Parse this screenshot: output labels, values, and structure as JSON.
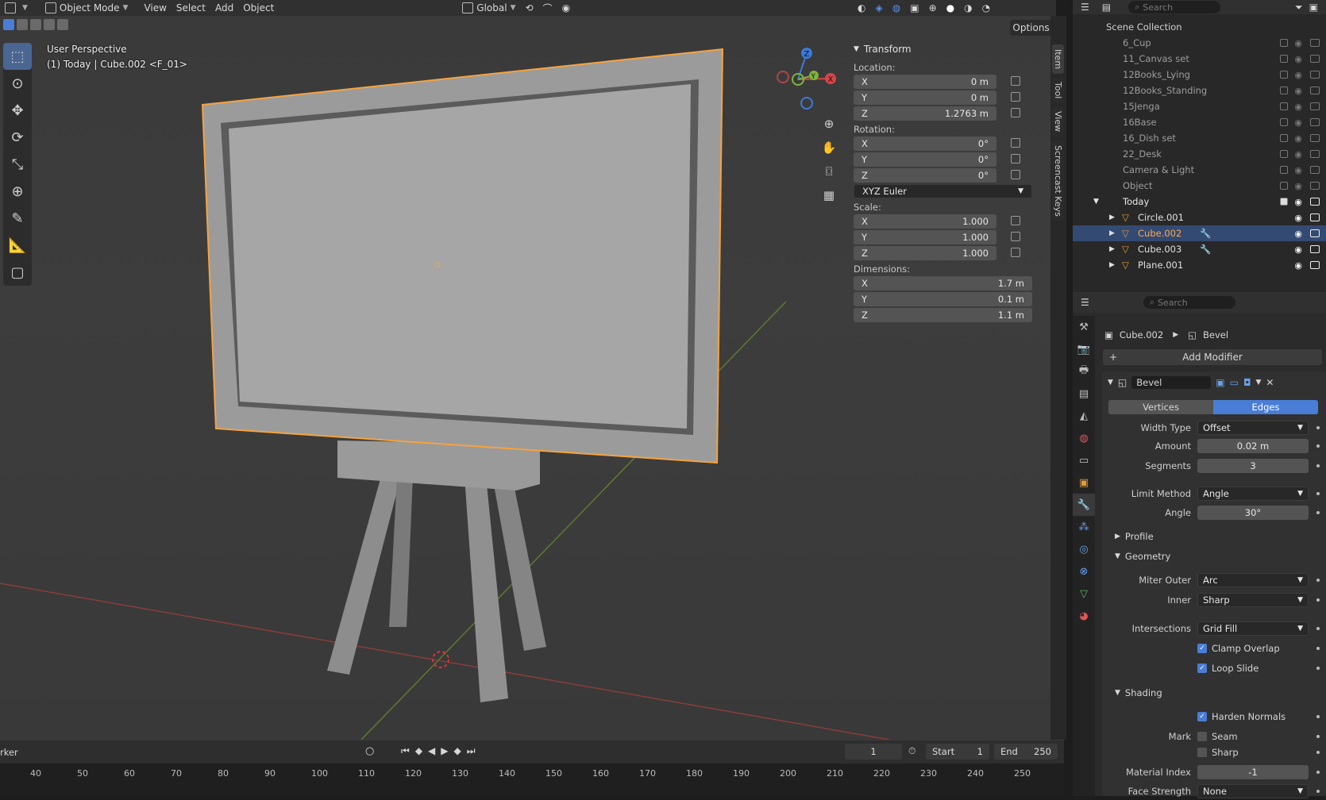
{
  "header": {
    "editor_icon": "viewport-icon",
    "mode": "Object Mode",
    "menus": [
      "View",
      "Select",
      "Add",
      "Object"
    ],
    "orientation": "Global",
    "options_label": "Options"
  },
  "viewport": {
    "perspective_label": "User Perspective",
    "object_info": "(1) Today | Cube.002 <F_01>",
    "gizmo_axes": [
      "Z",
      "Y",
      "X"
    ]
  },
  "npanel": {
    "section": "Transform",
    "location_label": "Location:",
    "location": [
      {
        "axis": "X",
        "value": "0 m"
      },
      {
        "axis": "Y",
        "value": "0 m"
      },
      {
        "axis": "Z",
        "value": "1.2763 m"
      }
    ],
    "rotation_label": "Rotation:",
    "rotation": [
      {
        "axis": "X",
        "value": "0°"
      },
      {
        "axis": "Y",
        "value": "0°"
      },
      {
        "axis": "Z",
        "value": "0°"
      }
    ],
    "rotation_mode": "XYZ Euler",
    "scale_label": "Scale:",
    "scale": [
      {
        "axis": "X",
        "value": "1.000"
      },
      {
        "axis": "Y",
        "value": "1.000"
      },
      {
        "axis": "Z",
        "value": "1.000"
      }
    ],
    "dimensions_label": "Dimensions:",
    "dimensions": [
      {
        "axis": "X",
        "value": "1.7 m"
      },
      {
        "axis": "Y",
        "value": "0.1 m"
      },
      {
        "axis": "Z",
        "value": "1.1 m"
      }
    ],
    "side_tabs": [
      "Item",
      "Tool",
      "View",
      "Screencast Keys"
    ]
  },
  "outliner": {
    "search_placeholder": "Search",
    "root": "Scene Collection",
    "collections": [
      "6_Cup",
      "11_Canvas set",
      "12Books_Lying",
      "12Books_Standing",
      "15Jenga",
      "16Base",
      "16_Dish set",
      "22_Desk",
      "Camera & Light",
      "Object"
    ],
    "active_collection": "Today",
    "objects": [
      "Circle.001",
      "Cube.002",
      "Cube.003",
      "Plane.001"
    ],
    "selected_object": "Cube.002"
  },
  "properties": {
    "search_placeholder": "Search",
    "breadcrumb_object": "Cube.002",
    "breadcrumb_modifier": "Bevel",
    "add_modifier": "Add Modifier",
    "modifier_name": "Bevel",
    "affect_tabs": [
      "Vertices",
      "Edges"
    ],
    "active_affect": "Edges",
    "width_type_label": "Width Type",
    "width_type": "Offset",
    "amount_label": "Amount",
    "amount": "0.02 m",
    "segments_label": "Segments",
    "segments": "3",
    "limit_method_label": "Limit Method",
    "limit_method": "Angle",
    "angle_label": "Angle",
    "angle": "30°",
    "profile_label": "Profile",
    "geometry_label": "Geometry",
    "miter_outer_label": "Miter Outer",
    "miter_outer": "Arc",
    "inner_label": "Inner",
    "inner": "Sharp",
    "intersections_label": "Intersections",
    "intersections": "Grid Fill",
    "clamp_overlap": "Clamp Overlap",
    "loop_slide": "Loop Slide",
    "shading_label": "Shading",
    "harden_normals": "Harden Normals",
    "mark_label": "Mark",
    "seam": "Seam",
    "sharp": "Sharp",
    "material_index_label": "Material Index",
    "material_index": "-1",
    "face_strength_label": "Face Strength",
    "face_strength": "None"
  },
  "timeline": {
    "marker_label": "rker",
    "current_frame": "1",
    "start_label": "Start",
    "start": "1",
    "end_label": "End",
    "end": "250",
    "ticks": [
      "40",
      "50",
      "60",
      "70",
      "80",
      "90",
      "100",
      "110",
      "120",
      "130",
      "140",
      "150",
      "160",
      "170",
      "180",
      "190",
      "200",
      "210",
      "220",
      "230",
      "240",
      "250"
    ]
  },
  "colors": {
    "selection_orange": "#f5a340",
    "highlight_blue": "#4a7dd6",
    "selected_row": "#334a72"
  }
}
